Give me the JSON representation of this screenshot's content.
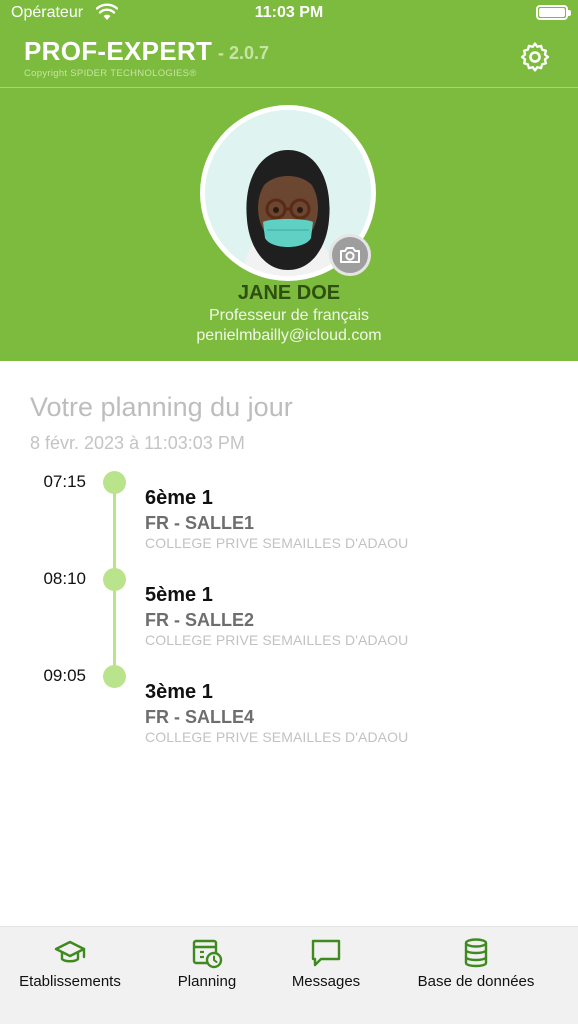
{
  "status_bar": {
    "carrier": "Opérateur",
    "time": "11:03 PM"
  },
  "header": {
    "title": "PROF-EXPERT",
    "version": "- 2.0.7",
    "copyright": "Copyright SPIDER TECHNOLOGIES®"
  },
  "profile": {
    "name": "JANE DOE",
    "role": "Professeur de français",
    "email": "penielmbailly@icloud.com"
  },
  "planning": {
    "title": "Votre planning du jour",
    "date": "8 févr. 2023 à 11:03:03 PM",
    "items": [
      {
        "time": "07:15",
        "class": "6ème 1",
        "room": "FR - SALLE1",
        "school": "COLLEGE PRIVE SEMAILLES D'ADAOU"
      },
      {
        "time": "08:10",
        "class": "5ème 1",
        "room": "FR - SALLE2",
        "school": "COLLEGE PRIVE SEMAILLES D'ADAOU"
      },
      {
        "time": "09:05",
        "class": "3ème 1",
        "room": "FR - SALLE4",
        "school": "COLLEGE PRIVE SEMAILLES D'ADAOU"
      }
    ]
  },
  "tabbar": {
    "tabs": [
      {
        "label": "Etablissements",
        "icon": "graduation-cap-icon"
      },
      {
        "label": "Planning",
        "icon": "calendar-clock-icon"
      },
      {
        "label": "Messages",
        "icon": "message-icon"
      },
      {
        "label": "Base de données",
        "icon": "database-icon"
      }
    ]
  },
  "colors": {
    "brand_green": "#7cbb3e",
    "timeline_green": "#b9e48c",
    "tab_icon_green": "#3f8a1e"
  }
}
